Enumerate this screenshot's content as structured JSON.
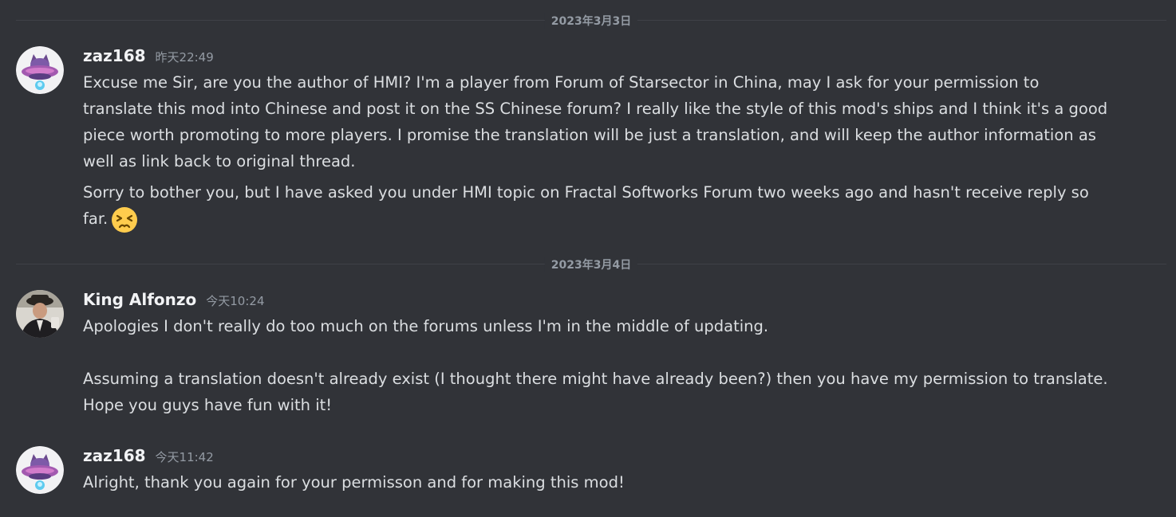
{
  "dividers": [
    {
      "label": "2023年3月3日"
    },
    {
      "label": "2023年3月4日"
    }
  ],
  "messages": [
    {
      "username": "zaz168",
      "timestamp": "昨天22:49",
      "paragraphs": [
        "Excuse me Sir, are you the author of HMI? I'm a player from Forum of Starsector in China, may I ask for your permission to translate this mod into Chinese and post it on the SS Chinese forum? I really like the style of this mod's ships and I think it's a good piece worth promoting to more players. I promise the translation will be just a translation, and will keep the author information as well as link back to original thread.",
        "Sorry to bother you, but I have asked you under HMI topic on Fractal Softworks Forum two weeks ago and hasn't receive reply so far."
      ],
      "emoji": "persevering-face-emoji"
    },
    {
      "username": "King Alfonzo",
      "timestamp": "今天10:24",
      "paragraphs": [
        "Apologies I don't really do too much on the forums unless I'm in the middle of updating.",
        "Assuming a translation doesn't already exist (I thought there might have already been?) then you have my permission to translate. Hope you guys have fun with it!"
      ]
    },
    {
      "username": "zaz168",
      "timestamp": "今天11:42",
      "paragraphs": [
        "Alright, thank you again for your permisson and for making this mod!"
      ]
    }
  ],
  "colors": {
    "background": "#313338",
    "text": "#dbdee1",
    "username": "#f2f3f5",
    "muted": "#949ba4",
    "divider": "#3f4147"
  }
}
